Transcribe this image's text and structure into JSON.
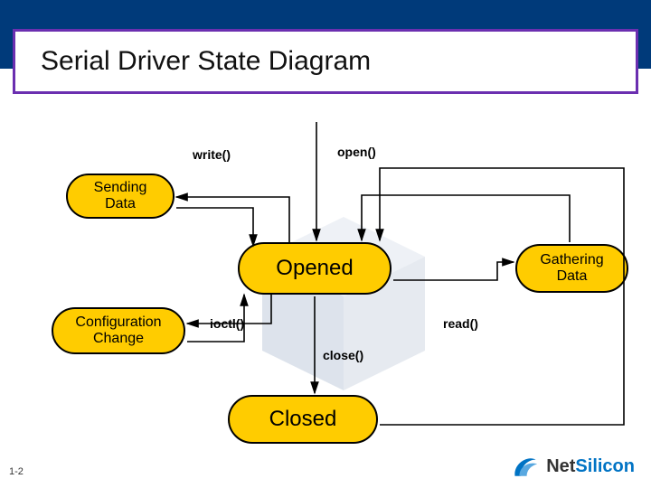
{
  "title": "Serial Driver State Diagram",
  "labels": {
    "write": "write()",
    "open": "open()",
    "ioctl": "ioctl()",
    "read": "read()",
    "close": "close()"
  },
  "states": {
    "sending_data": "Sending\nData",
    "opened": "Opened",
    "gathering_data": "Gathering\nData",
    "configuration_change": "Configuration\nChange",
    "closed": "Closed"
  },
  "page_number": "1-2",
  "brand": {
    "name_part1": "Net",
    "name_part2": "Silicon"
  }
}
